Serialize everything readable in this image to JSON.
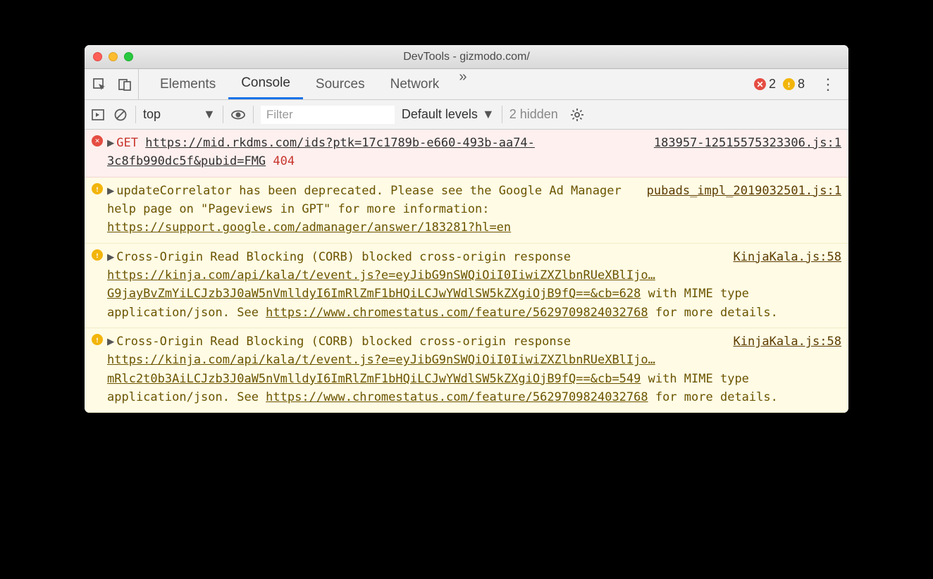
{
  "window": {
    "title": "DevTools - gizmodo.com/"
  },
  "tabs": {
    "items": [
      "Elements",
      "Console",
      "Sources",
      "Network"
    ],
    "active": 1,
    "overflow": "»"
  },
  "counts": {
    "errors": "2",
    "warnings": "8"
  },
  "toolbar": {
    "context": "top",
    "filter_placeholder": "Filter",
    "levels": "Default levels",
    "hidden": "2 hidden"
  },
  "messages": [
    {
      "type": "error",
      "method": "GET",
      "url": "https://mid.rkdms.com/ids?ptk=17c1789b-e660-493b-aa74-3c8fb990dc5f&pubid=FMG",
      "status": "404",
      "source": "183957-12515575323306.js:1"
    },
    {
      "type": "warn",
      "text_before": "updateCorrelator has been deprecated. Please see the Google Ad Manager help page on \"Pageviews in GPT\" for more information: ",
      "link": "https://support.google.com/admanager/answer/183281?hl=en",
      "source": "pubads_impl_2019032501.js:1"
    },
    {
      "type": "warn",
      "text_before": "Cross-Origin Read Blocking (CORB) blocked cross-origin response ",
      "link": "https://kinja.com/api/kala/t/event.js?e=eyJibG9nSWQiOiI0IiwiZXZlbnRUeXBlIjo…G9jayBvZmYiLCJzb3J0aW5nVmlldyI6ImRlZmF1bHQiLCJwYWdlSW5kZXgiOjB9fQ==&cb=628",
      "text_mid": " with MIME type application/json. See ",
      "link2": "https://www.chromestatus.com/feature/5629709824032768",
      "text_after": " for more details.",
      "source": "KinjaKala.js:58"
    },
    {
      "type": "warn",
      "text_before": "Cross-Origin Read Blocking (CORB) blocked cross-origin response ",
      "link": "https://kinja.com/api/kala/t/event.js?e=eyJibG9nSWQiOiI0IiwiZXZlbnRUeXBlIjo…mRlc2t0b3AiLCJzb3J0aW5nVmlldyI6ImRlZmF1bHQiLCJwYWdlSW5kZXgiOjB9fQ==&cb=549",
      "text_mid": " with MIME type application/json. See ",
      "link2": "https://www.chromestatus.com/feature/5629709824032768",
      "text_after": " for more details.",
      "source": "KinjaKala.js:58"
    }
  ]
}
